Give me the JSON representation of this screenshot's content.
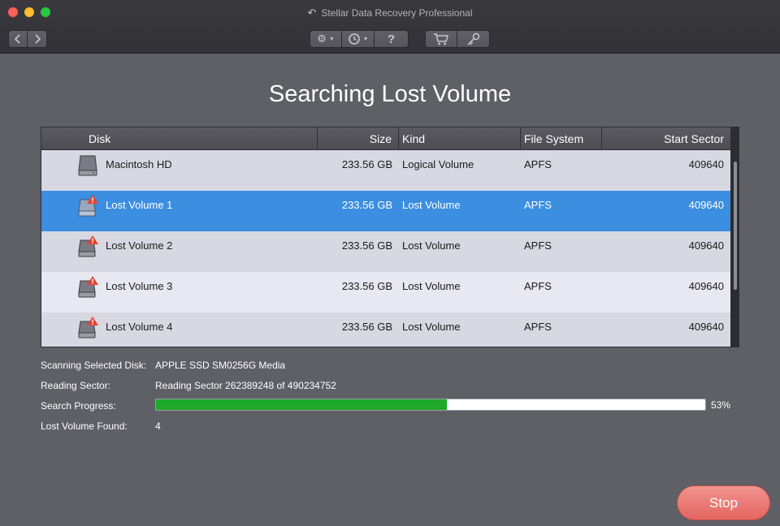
{
  "window": {
    "title": "Stellar Data Recovery Professional"
  },
  "toolbar": {
    "back_icon": "chevron-left-icon",
    "forward_icon": "chevron-right-icon",
    "settings_icon": "gear-icon",
    "history_icon": "history-icon",
    "help_label": "?",
    "cart_icon": "cart-icon",
    "key_icon": "key-icon"
  },
  "heading": "Searching Lost Volume",
  "table": {
    "columns": {
      "disk": "Disk",
      "size": "Size",
      "kind": "Kind",
      "file_system": "File System",
      "start_sector": "Start Sector"
    },
    "rows": [
      {
        "name": "Macintosh HD",
        "size": "233.56 GB",
        "kind": "Logical Volume",
        "file_system": "APFS",
        "start_sector": "409640",
        "selected": false,
        "warning": false
      },
      {
        "name": "Lost Volume 1",
        "size": "233.56 GB",
        "kind": "Lost Volume",
        "file_system": "APFS",
        "start_sector": "409640",
        "selected": true,
        "warning": true
      },
      {
        "name": "Lost Volume 2",
        "size": "233.56 GB",
        "kind": "Lost Volume",
        "file_system": "APFS",
        "start_sector": "409640",
        "selected": false,
        "warning": true
      },
      {
        "name": "Lost Volume 3",
        "size": "233.56 GB",
        "kind": "Lost Volume",
        "file_system": "APFS",
        "start_sector": "409640",
        "selected": false,
        "warning": true
      },
      {
        "name": "Lost Volume 4",
        "size": "233.56 GB",
        "kind": "Lost Volume",
        "file_system": "APFS",
        "start_sector": "409640",
        "selected": false,
        "warning": true
      }
    ]
  },
  "status": {
    "scanning_label": "Scanning Selected Disk:",
    "scanning_value": "APPLE SSD SM0256G Media",
    "reading_label": "Reading Sector:",
    "reading_value": "Reading Sector 262389248 of 490234752",
    "progress_label": "Search Progress:",
    "progress_value": 0.53,
    "progress_text": "53%",
    "found_label": "Lost Volume Found:",
    "found_value": "4"
  },
  "stop_label": "Stop",
  "colors": {
    "selected_row": "#3b8ee0",
    "progress_fill": "#1fa92b",
    "stop_button": "#e46560",
    "warning": "#e8412c"
  }
}
